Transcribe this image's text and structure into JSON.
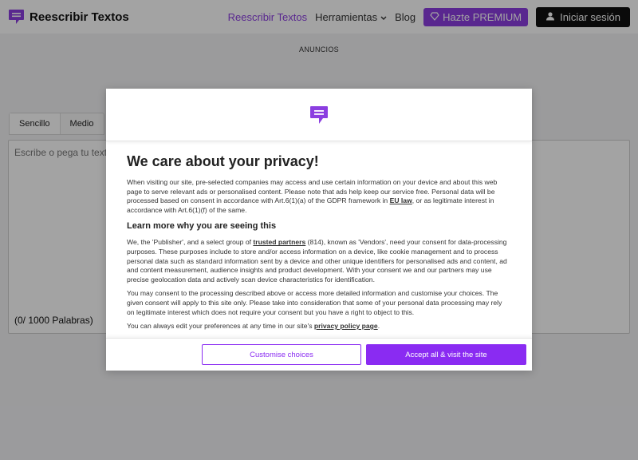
{
  "header": {
    "brand": "Reescribir Textos",
    "nav": {
      "active": "Reescribir Textos",
      "tools": "Herramientas",
      "blog": "Blog",
      "premium": "Hazte PREMIUM",
      "login": "Iniciar sesión"
    }
  },
  "ads_label": "ANUNCIOS",
  "editor": {
    "tabs": [
      "Sencillo",
      "Medio"
    ],
    "placeholder": "Escribe o pega tu texto",
    "word_count": "(0/ 1000 Palabras)"
  },
  "consent": {
    "title": "We care about your privacy!",
    "p1_a": "When visiting our site, pre-selected companies may access and use certain information on your device and about this web page to serve relevant ads or personalised content. Please note that ads help keep our service free. Personal data will be processed based on consent in accordance with Art.6(1)(a) of the GDPR framework in ",
    "p1_link": "EU law",
    "p1_b": ", or as legitimate interest in accordance with Art.6(1)(f) of the same.",
    "subtitle": "Learn more why you are seeing this",
    "p2_a": "We, the 'Publisher', and a select group of ",
    "p2_link": "trusted partners",
    "p2_b": " (814), known as 'Vendors', need your consent for data-processing purposes. These purposes include to store and/or access information on a device, like cookie management and to process personal data such as standard information sent by a device and other unique identifiers for personalised ads and content, ad and content measurement, audience insights and product development. With your consent we and our partners may use precise geolocation data and actively scan device characteristics for identification.",
    "p3": "You may consent to the processing described above or access more detailed information and customise your choices. The given consent will apply to this site only. Please take into consideration that some of your personal data processing may rely on legitimate interest which does not require your consent but you have a right to object to this.",
    "p4_a": "You can always edit your preferences at any time in our site's ",
    "p4_link": "privacy policy page",
    "p4_b": ".",
    "customise": "Customise choices",
    "accept": "Accept all & visit the site"
  },
  "colors": {
    "accent": "#8a2bf2",
    "overlay": "#5c5c5e"
  },
  "icons": [
    "chat-bubble-icon",
    "chevron-down-icon",
    "diamond-icon",
    "user-icon"
  ]
}
